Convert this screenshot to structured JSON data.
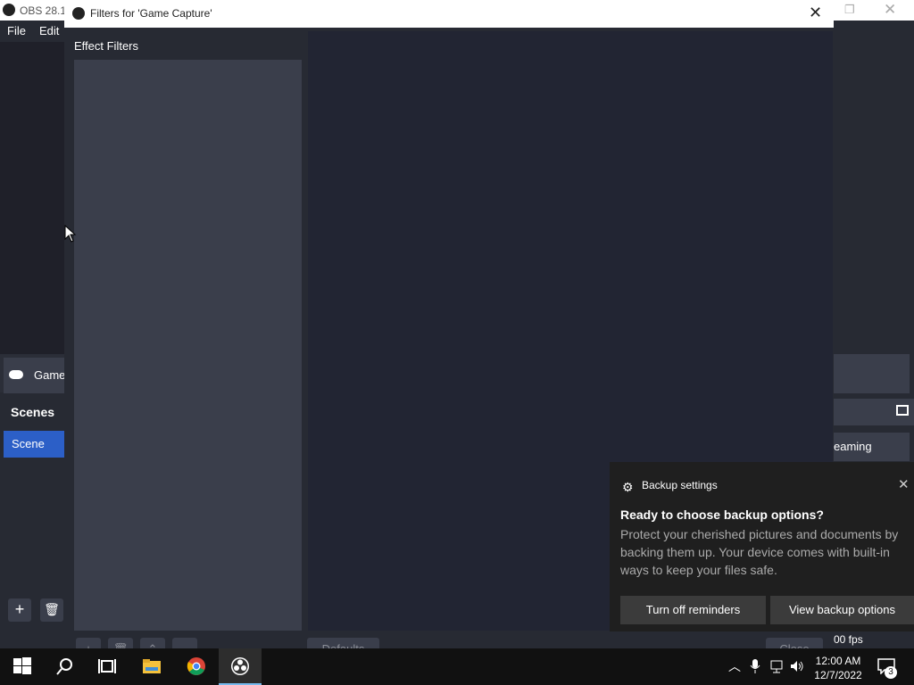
{
  "obs_window": {
    "title": "OBS 28.1",
    "menu": [
      "File",
      "Edit"
    ],
    "source_item": "Game",
    "scenes_header": "Scenes",
    "scene_item": "Scene",
    "stream_button": "eaming",
    "fps": "00 fps"
  },
  "filters_dialog": {
    "title": "Filters for 'Game Capture'",
    "effect_filters_label": "Effect Filters",
    "defaults_button": "Defaults",
    "close_button": "Close"
  },
  "notification": {
    "app_name": "Backup settings",
    "heading": "Ready to choose backup options?",
    "body": "Protect your cherished pictures and documents by backing them up. Your device comes with built-in ways to keep your files safe.",
    "btn_turn_off": "Turn off reminders",
    "btn_view": "View backup options"
  },
  "taskbar": {
    "time": "12:00 AM",
    "date": "12/7/2022",
    "notification_count": "3",
    "icons": [
      "windows-start-icon",
      "search-icon",
      "task-view-icon",
      "file-explorer-icon",
      "chrome-icon",
      "obs-icon"
    ]
  },
  "colors": {
    "accent": "#2c5fc7",
    "panel": "#3a3e4b",
    "bg": "#272a33"
  }
}
